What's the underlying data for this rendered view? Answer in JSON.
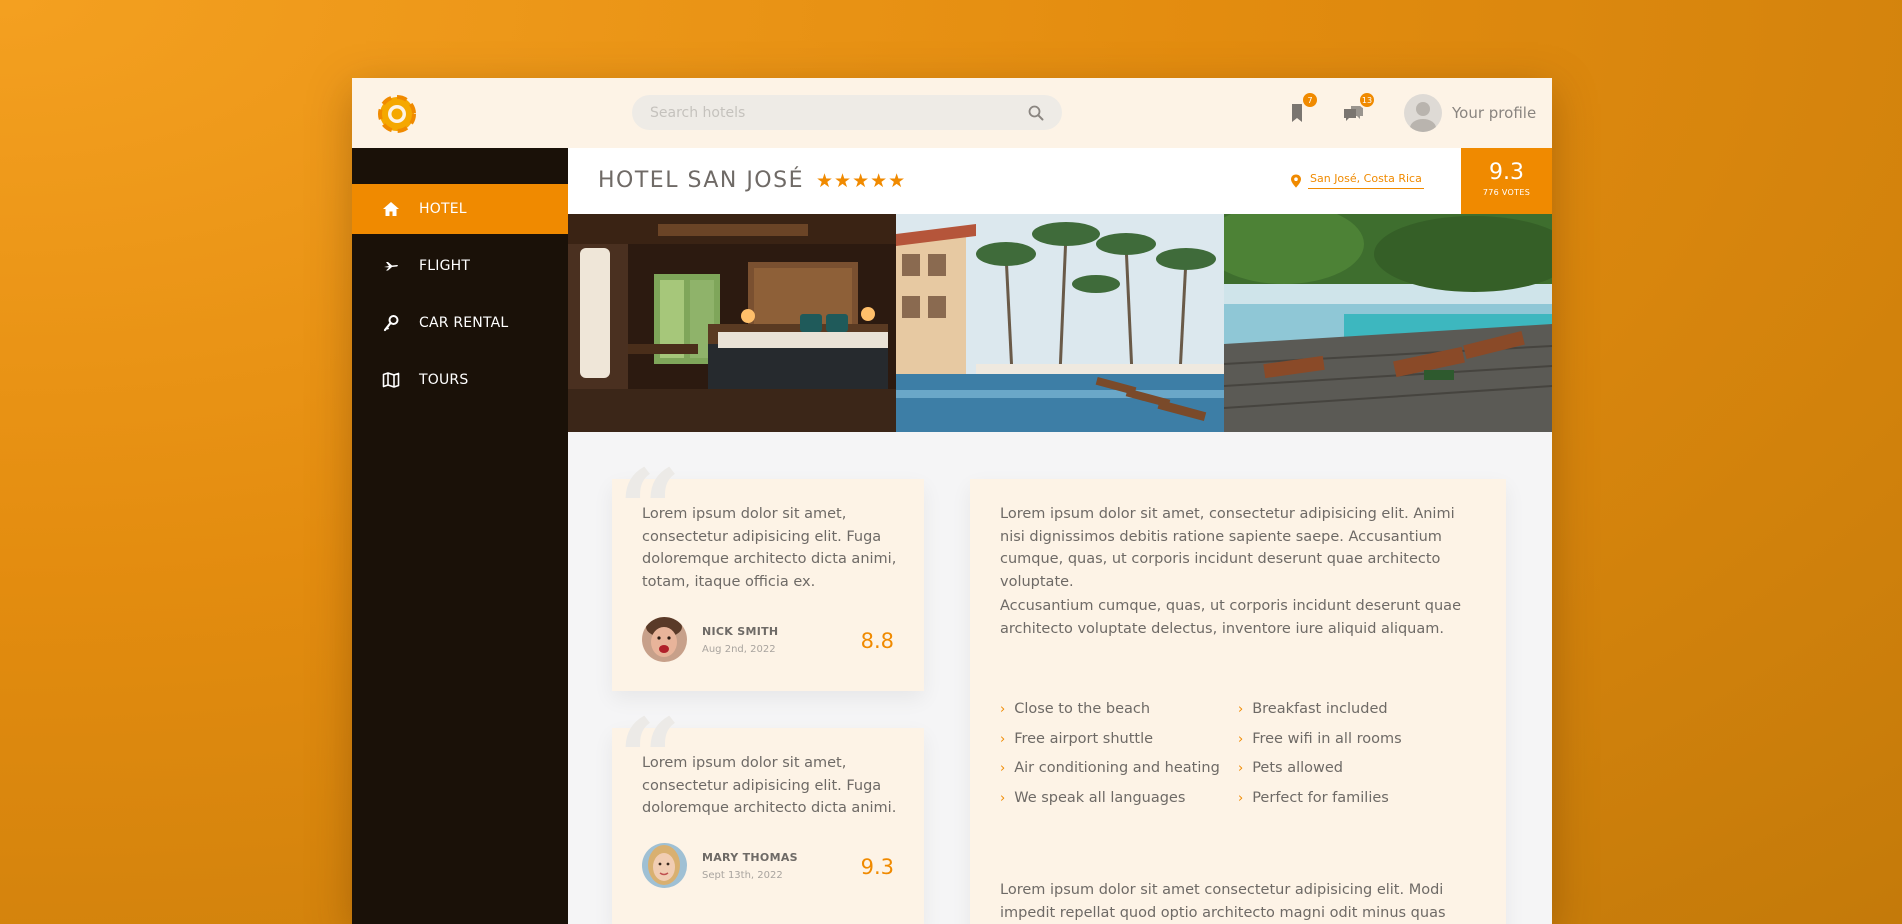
{
  "search": {
    "placeholder": "Search hotels"
  },
  "header": {
    "bookmarks_count": "7",
    "messages_count": "13",
    "profile_label": "Your profile"
  },
  "sidebar": {
    "items": [
      {
        "label": "HOTEL",
        "icon": "home-icon",
        "active": true
      },
      {
        "label": "FLIGHT",
        "icon": "plane-icon",
        "active": false
      },
      {
        "label": "CAR RENTAL",
        "icon": "key-icon",
        "active": false
      },
      {
        "label": "TOURS",
        "icon": "map-icon",
        "active": false
      }
    ]
  },
  "hotel": {
    "name": "HOTEL SAN JOSÉ",
    "stars": "★★★★★",
    "location": "San José, Costa Rica",
    "score": "9.3",
    "votes": "776 VOTES"
  },
  "reviews": [
    {
      "text": "Lorem ipsum dolor sit amet, consectetur adipisicing elit. Fuga doloremque architecto dicta animi, totam, itaque officia ex.",
      "name": "NICK SMITH",
      "date": "Aug 2nd, 2022",
      "score": "8.8"
    },
    {
      "text": "Lorem ipsum dolor sit amet, consectetur adipisicing elit. Fuga doloremque architecto dicta animi.",
      "name": "MARY THOMAS",
      "date": "Sept 13th, 2022",
      "score": "9.3"
    }
  ],
  "description": {
    "paragraphs": [
      "Lorem ipsum dolor sit amet, consectetur adipisicing elit. Animi nisi dignissimos debitis ratione sapiente saepe. Accusantium cumque, quas, ut corporis incidunt deserunt quae architecto voluptate.",
      "Accusantium cumque, quas, ut corporis incidunt deserunt quae architecto voluptate delectus, inventore iure aliquid aliquam.",
      "Lorem ipsum dolor sit amet consectetur adipisicing elit. Modi impedit repellat quod optio architecto magni odit minus quas"
    ],
    "amenities_left": [
      "Close to the beach",
      "Free airport shuttle",
      "Air conditioning and heating",
      "We speak all languages"
    ],
    "amenities_right": [
      "Breakfast included",
      "Free wifi in all rooms",
      "Pets allowed",
      "Perfect for families"
    ]
  },
  "colors": {
    "accent": "#f08a00",
    "sidebar": "#1a1108",
    "card": "#fdf3e6"
  }
}
